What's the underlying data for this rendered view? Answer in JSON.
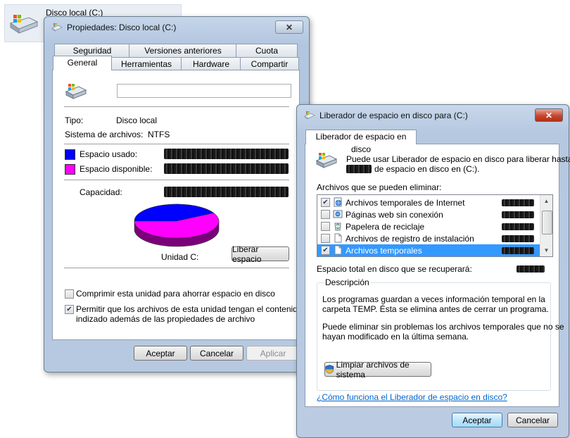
{
  "explorer": {
    "drive_name": "Disco local (C:)",
    "drive_icon": "drive-icon"
  },
  "properties_window": {
    "title": "Propiedades: Disco local (C:)",
    "tabs_row1": [
      "Seguridad",
      "Versiones anteriores",
      "Cuota"
    ],
    "tabs_row2": [
      "General",
      "Herramientas",
      "Hardware",
      "Compartir"
    ],
    "active_tab": "General",
    "label_input_value": "",
    "type_label": "Tipo:",
    "type_value": "Disco local",
    "fs_label": "Sistema de archivos:",
    "fs_value": "NTFS",
    "used_label": "Espacio usado:",
    "free_label": "Espacio disponible:",
    "capacity_label": "Capacidad:",
    "used_color": "#0000ff",
    "free_color": "#ff00ff",
    "drive_caption": "Unidad C:",
    "used_fraction": 0.42,
    "cleanup_button": "Liberar espacio",
    "compress_label": "Comprimir esta unidad para ahorrar espacio en disco",
    "compress_checked": false,
    "index_label_line1": "Permitir que los archivos de esta unidad tengan el contenido",
    "index_label_line2": "indizado además de las propiedades de archivo",
    "index_checked": true,
    "ok_button": "Aceptar",
    "cancel_button": "Cancelar",
    "apply_button": "Aplicar"
  },
  "cleanup_window": {
    "title": "Liberador de espacio en disco para  (C:)",
    "tab": "Liberador de espacio en disco",
    "intro_line1": "Puede usar Liberador de espacio en disco para liberar hasta",
    "intro_line2": "de espacio en disco en  (C:).",
    "files_label": "Archivos que se pueden eliminar:",
    "files": [
      {
        "label": "Archivos temporales de Internet",
        "checked": true,
        "icon": "internet-files-icon",
        "selected": false
      },
      {
        "label": "Páginas web sin conexión",
        "checked": false,
        "icon": "offline-pages-icon",
        "selected": false
      },
      {
        "label": "Papelera de reciclaje",
        "checked": false,
        "icon": "recycle-bin-icon",
        "selected": false
      },
      {
        "label": "Archivos de registro de instalación",
        "checked": false,
        "icon": "document-icon",
        "selected": false
      },
      {
        "label": "Archivos temporales",
        "checked": true,
        "icon": "document-icon",
        "selected": true
      }
    ],
    "total_label": "Espacio total en disco que se recuperará:",
    "description_title": "Descripción",
    "description_p1_line1": "Los programas guardan a veces información temporal en la",
    "description_p1_line2": "carpeta TEMP.  Ésta se elimina antes de cerrar un programa.",
    "description_p2_line1": "Puede eliminar sin problemas los archivos temporales que no se",
    "description_p2_line2": "hayan modificado en la última semana.",
    "system_button": "Limpiar archivos de sistema",
    "help_link": "¿Cómo funciona el Liberador de espacio en disco?",
    "ok_button": "Aceptar",
    "cancel_button": "Cancelar"
  }
}
